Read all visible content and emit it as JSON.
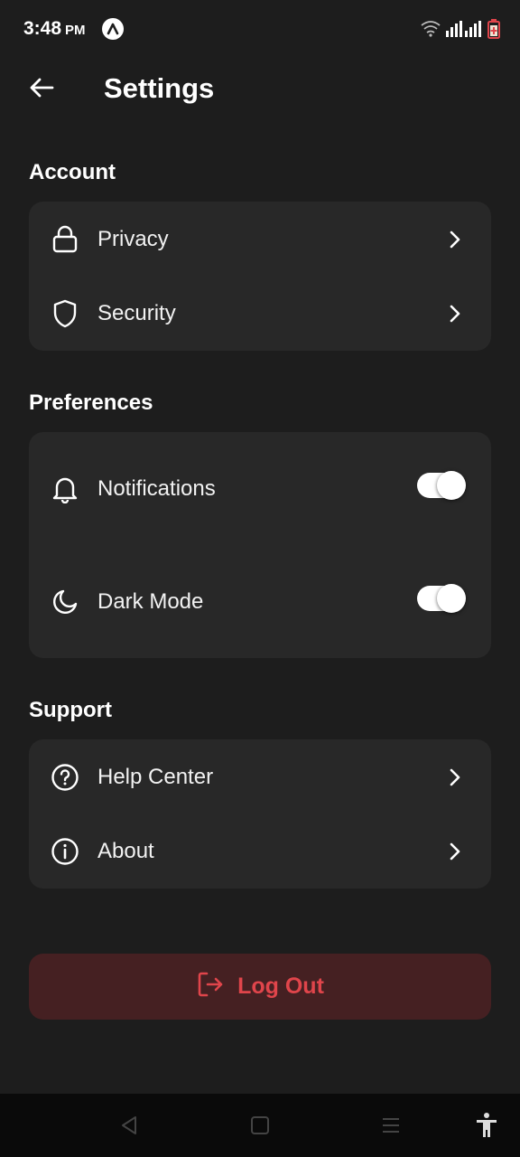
{
  "status_bar": {
    "time": "3:48",
    "ampm": "PM"
  },
  "header": {
    "title": "Settings"
  },
  "sections": {
    "account": {
      "title": "Account",
      "items": [
        {
          "label": "Privacy",
          "icon": "lock-icon"
        },
        {
          "label": "Security",
          "icon": "shield-icon"
        }
      ]
    },
    "preferences": {
      "title": "Preferences",
      "items": [
        {
          "label": "Notifications",
          "icon": "bell-icon",
          "enabled": true
        },
        {
          "label": "Dark Mode",
          "icon": "moon-icon",
          "enabled": true
        }
      ]
    },
    "support": {
      "title": "Support",
      "items": [
        {
          "label": "Help Center",
          "icon": "help-circle-icon"
        },
        {
          "label": "About",
          "icon": "info-icon"
        }
      ]
    }
  },
  "logout": {
    "label": "Log Out",
    "icon": "log-out-icon"
  },
  "colors": {
    "background": "#1d1d1d",
    "card": "#282828",
    "logout_bg": "#452022",
    "logout_text": "#e0454b"
  }
}
